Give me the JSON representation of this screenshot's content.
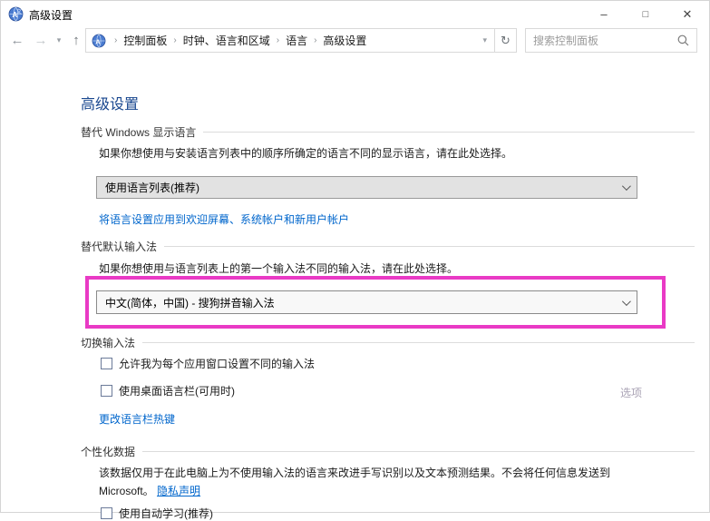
{
  "window": {
    "title": "高级设置",
    "controls": {
      "minimize": "–",
      "maximize": "□",
      "close": "✕"
    }
  },
  "toolbar": {
    "back_glyph": "←",
    "forward_glyph": "→",
    "history_chevron": "▾",
    "up_glyph": "↑",
    "refresh_glyph": "↻",
    "breadcrumb_separator": "›",
    "breadcrumb": [
      "控制面板",
      "时钟、语言和区域",
      "语言",
      "高级设置"
    ],
    "search_placeholder": "搜索控制面板"
  },
  "page": {
    "title": "高级设置"
  },
  "sections": {
    "display_language": {
      "title": "替代 Windows 显示语言",
      "description": "如果你想使用与安装语言列表中的顺序所确定的语言不同的显示语言，请在此处选择。",
      "dropdown_value": "使用语言列表(推荐)",
      "apply_link": "将语言设置应用到欢迎屏幕、系统帐户和新用户帐户"
    },
    "default_input_method": {
      "title": "替代默认输入法",
      "description": "如果你想使用与语言列表上的第一个输入法不同的输入法，请在此处选择。",
      "dropdown_value": "中文(简体，中国) - 搜狗拼音输入法"
    },
    "switching_input_methods": {
      "title": "切换输入法",
      "checkbox_per_app": "允许我为每个应用窗口设置不同的输入法",
      "checkbox_language_bar": "使用桌面语言栏(可用时)",
      "options_label": "选项",
      "hotkey_link": "更改语言栏热键"
    },
    "personalization_data": {
      "title": "个性化数据",
      "description_line1": "该数据仅用于在此电脑上为不使用输入法的语言来改进手写识别以及文本预测结果。不会将任何信息发送到",
      "description_line2_prefix": "Microsoft。",
      "privacy_link": "隐私声明",
      "cutoff_checkbox_label": "使用自动学习(推荐)"
    }
  },
  "colors": {
    "link_blue": "#0066cc",
    "heading_blue": "#19478f",
    "highlight_magenta": "#e93ac5",
    "disabled_option_link": "#a9a2b4"
  }
}
